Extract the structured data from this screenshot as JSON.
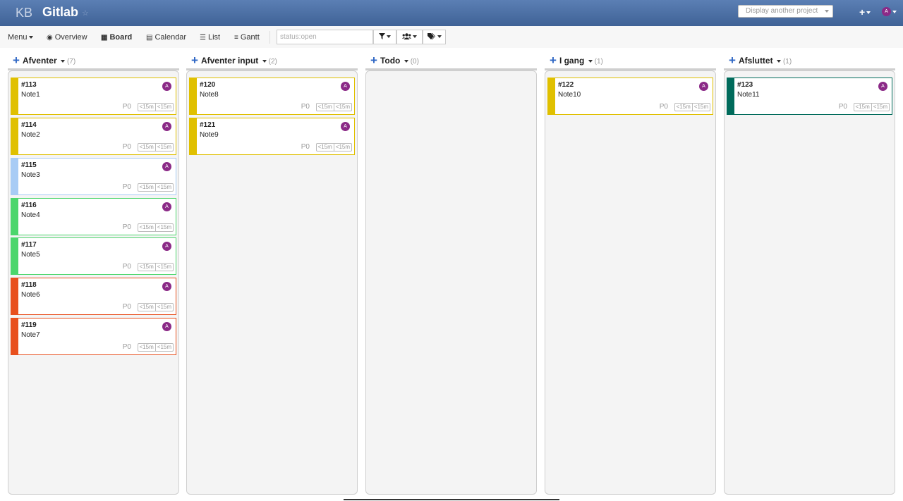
{
  "header": {
    "logo": "KB",
    "title": "Gitlab",
    "project_select_placeholder": "Display another project",
    "plus_label": "+",
    "user_initial": "A"
  },
  "toolbar": {
    "menu": "Menu",
    "overview": "Overview",
    "board": "Board",
    "calendar": "Calendar",
    "list": "List",
    "gantt": "Gantt",
    "search_placeholder": "status:open"
  },
  "columns": [
    {
      "name": "Afventer",
      "count": "(7)",
      "cards": [
        {
          "num": "#113",
          "title": "Note1",
          "avatar": "A",
          "priority": "P0",
          "t1": "<15m",
          "t2": "<15m",
          "color": "#e0c000"
        },
        {
          "num": "#114",
          "title": "Note2",
          "avatar": "A",
          "priority": "P0",
          "t1": "<15m",
          "t2": "<15m",
          "color": "#e0c000"
        },
        {
          "num": "#115",
          "title": "Note3",
          "avatar": "A",
          "priority": "P0",
          "t1": "<15m",
          "t2": "<15m",
          "color": "#a8ccf5"
        },
        {
          "num": "#116",
          "title": "Note4",
          "avatar": "A",
          "priority": "P0",
          "t1": "<15m",
          "t2": "<15m",
          "color": "#4cd66c"
        },
        {
          "num": "#117",
          "title": "Note5",
          "avatar": "A",
          "priority": "P0",
          "t1": "<15m",
          "t2": "<15m",
          "color": "#4cd66c"
        },
        {
          "num": "#118",
          "title": "Note6",
          "avatar": "A",
          "priority": "P0",
          "t1": "<15m",
          "t2": "<15m",
          "color": "#e8501e"
        },
        {
          "num": "#119",
          "title": "Note7",
          "avatar": "A",
          "priority": "P0",
          "t1": "<15m",
          "t2": "<15m",
          "color": "#e8501e"
        }
      ]
    },
    {
      "name": "Afventer input",
      "count": "(2)",
      "cards": [
        {
          "num": "#120",
          "title": "Note8",
          "avatar": "A",
          "priority": "P0",
          "t1": "<15m",
          "t2": "<15m",
          "color": "#e0c000"
        },
        {
          "num": "#121",
          "title": "Note9",
          "avatar": "A",
          "priority": "P0",
          "t1": "<15m",
          "t2": "<15m",
          "color": "#e0c000"
        }
      ]
    },
    {
      "name": "Todo",
      "count": "(0)",
      "cards": []
    },
    {
      "name": "I gang",
      "count": "(1)",
      "cards": [
        {
          "num": "#122",
          "title": "Note10",
          "avatar": "A",
          "priority": "P0",
          "t1": "<15m",
          "t2": "<15m",
          "color": "#e0c000"
        }
      ]
    },
    {
      "name": "Afsluttet",
      "count": "(1)",
      "cards": [
        {
          "num": "#123",
          "title": "Note11",
          "avatar": "A",
          "priority": "P0",
          "t1": "<15m",
          "t2": "<15m",
          "color": "#006b5b"
        }
      ]
    }
  ]
}
